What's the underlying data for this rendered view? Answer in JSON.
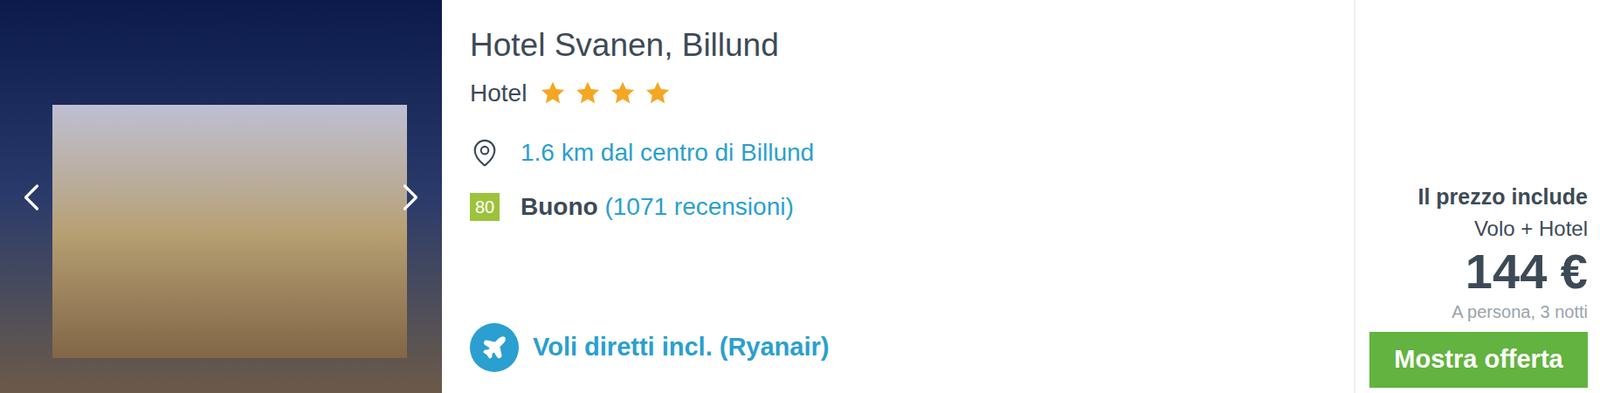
{
  "listing": {
    "title": "Hotel Svanen, Billund",
    "type": "Hotel",
    "stars": 4,
    "distance": "1.6 km dal centro di Billund",
    "rating": {
      "score": "80",
      "label": "Buono",
      "reviews": "(1071 recensioni)"
    },
    "flights": "Voli diretti incl. (Ryanair)"
  },
  "price": {
    "includes_label": "Il prezzo include",
    "includes": "Volo + Hotel",
    "amount": "144 €",
    "note": "A persona, 3 notti"
  },
  "button": "Mostra offerta"
}
